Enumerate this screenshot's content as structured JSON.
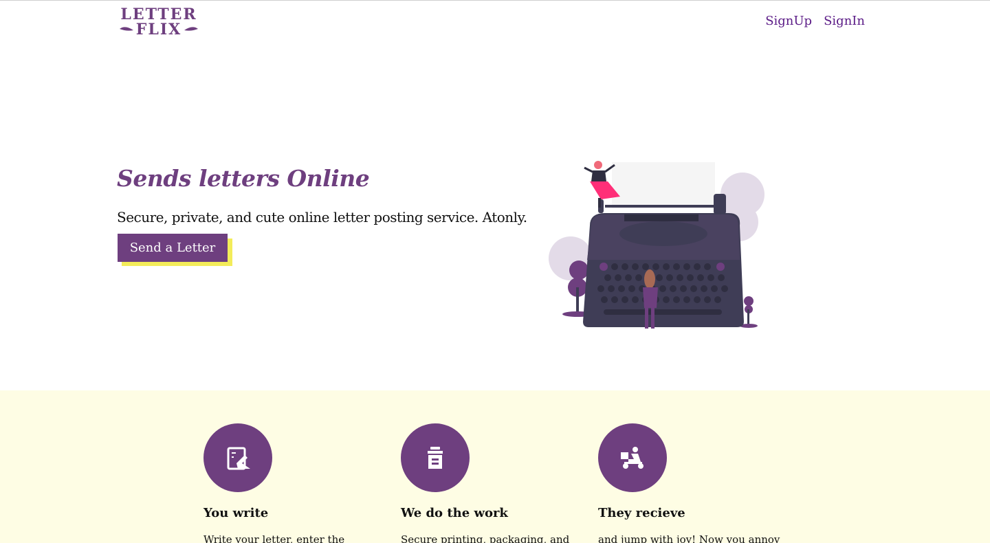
{
  "brand": {
    "logo_line1": "LETTER",
    "logo_line2": "FLIX"
  },
  "nav": {
    "signup": "SignUp",
    "signin": "SignIn"
  },
  "hero": {
    "title": "Sends letters Online",
    "subtitle": "Secure, private, and cute online letter posting service. Atonly.",
    "cta": "Send a Letter",
    "illustration_icon": "typewriter-illustration"
  },
  "features": [
    {
      "icon": "write-letter-icon",
      "title": "You write",
      "text": "Write your letter, enter the"
    },
    {
      "icon": "mailbox-icon",
      "title": "We do the work",
      "text": "Secure printing, packaging, and"
    },
    {
      "icon": "delivery-scooter-icon",
      "title": "They recieve",
      "text": "and jump with joy! Now you annoy"
    }
  ],
  "colors": {
    "primary": "#6e3f7f",
    "accent": "#f3ec5a",
    "features_bg": "#fefde4",
    "nav_link": "#5a1a86"
  }
}
